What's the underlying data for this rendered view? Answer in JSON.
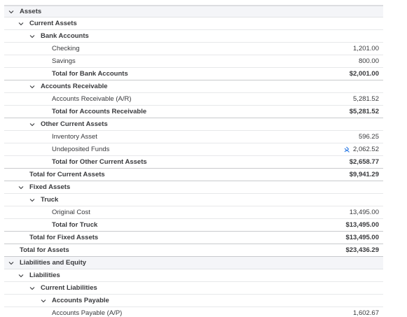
{
  "rows": [
    {
      "label": "Assets",
      "amount": ""
    },
    {
      "label": "Current Assets",
      "amount": ""
    },
    {
      "label": "Bank Accounts",
      "amount": ""
    },
    {
      "label": "Checking",
      "amount": "1,201.00"
    },
    {
      "label": "Savings",
      "amount": "800.00"
    },
    {
      "label": "Total for Bank Accounts",
      "amount": "$2,001.00"
    },
    {
      "label": "Accounts Receivable",
      "amount": ""
    },
    {
      "label": "Accounts Receivable (A/R)",
      "amount": "5,281.52"
    },
    {
      "label": "Total for Accounts Receivable",
      "amount": "$5,281.52"
    },
    {
      "label": "Other Current Assets",
      "amount": ""
    },
    {
      "label": "Inventory Asset",
      "amount": "596.25"
    },
    {
      "label": "Undeposited Funds",
      "amount": "2,062.52"
    },
    {
      "label": "Total for Other Current Assets",
      "amount": "$2,658.77"
    },
    {
      "label": "Total for Current Assets",
      "amount": "$9,941.29"
    },
    {
      "label": "Fixed Assets",
      "amount": ""
    },
    {
      "label": "Truck",
      "amount": ""
    },
    {
      "label": "Original Cost",
      "amount": "13,495.00"
    },
    {
      "label": "Total for Truck",
      "amount": "$13,495.00"
    },
    {
      "label": "Total for Fixed Assets",
      "amount": "$13,495.00"
    },
    {
      "label": "Total for Assets",
      "amount": "$23,436.29"
    },
    {
      "label": "Liabilities and Equity",
      "amount": ""
    },
    {
      "label": "Liabilities",
      "amount": ""
    },
    {
      "label": "Current Liabilities",
      "amount": ""
    },
    {
      "label": "Accounts Payable",
      "amount": ""
    },
    {
      "label": "Accounts Payable (A/P)",
      "amount": "1,602.67"
    }
  ],
  "icons": {
    "collapse": "chevron-down-icon",
    "link": "linked-transaction-icon"
  },
  "colors": {
    "link_icon": "#2c7be5",
    "text": "#393a3d"
  }
}
